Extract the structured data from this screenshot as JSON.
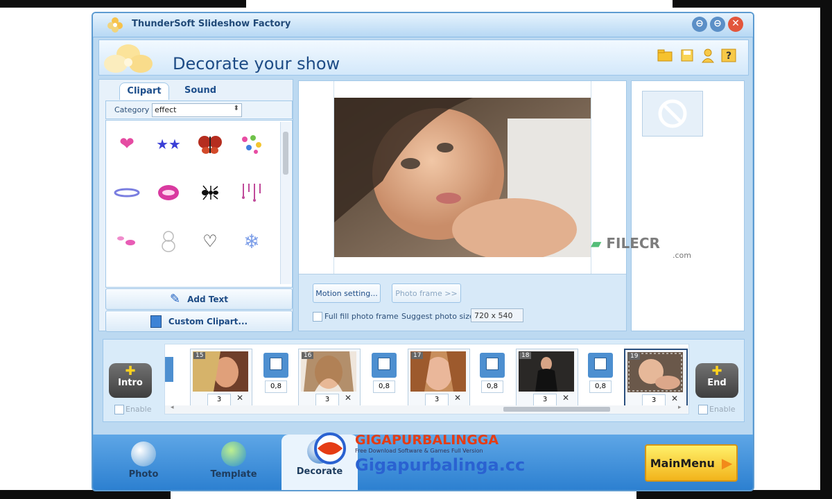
{
  "window": {
    "title": "ThunderSoft Slideshow Factory"
  },
  "header": {
    "title": "Decorate your show"
  },
  "left_panel": {
    "tabs": [
      "Clipart",
      "Sound"
    ],
    "category_label": "Category",
    "category_value": "effect",
    "cliparts": [
      "heart",
      "stars",
      "butterfly",
      "flowers",
      "ring",
      "lips",
      "ant",
      "drips",
      "petals",
      "outline-8",
      "hearts-outline",
      "snowflake"
    ],
    "add_text": "Add Text",
    "custom_clipart": "Custom Clipart..."
  },
  "preview": {
    "motion_button": "Motion setting...",
    "photo_frame_button": "Photo frame >>",
    "full_fill_label": "Full fill photo frame",
    "suggest_label": "Suggest photo size:",
    "suggest_value": "720 x 540"
  },
  "timeline": {
    "intro_label": "Intro",
    "end_label": "End",
    "enable_label": "Enable",
    "slides": [
      {
        "num": "15",
        "duration": "3",
        "transition": "0,8"
      },
      {
        "num": "16",
        "duration": "3",
        "transition": "0,8"
      },
      {
        "num": "17",
        "duration": "3",
        "transition": "0,8"
      },
      {
        "num": "18",
        "duration": "3",
        "transition": "0,8"
      },
      {
        "num": "19",
        "duration": "3"
      }
    ]
  },
  "nav": {
    "photo": "Photo",
    "template": "Template",
    "decorate": "Decorate",
    "main_menu": "MainMenu"
  },
  "watermarks": {
    "filecr": "FILECR",
    "filecr_com": ".com",
    "giga_title": "GIGAPURBALINGGA",
    "giga_sub": "Free Download Software & Games Full Version",
    "giga_site": "Gigapurbalinga.cc"
  },
  "colors": {
    "accent": "#5d9bd1",
    "nav": "#2b7fd0",
    "mainmenu": "#f2b41b"
  }
}
